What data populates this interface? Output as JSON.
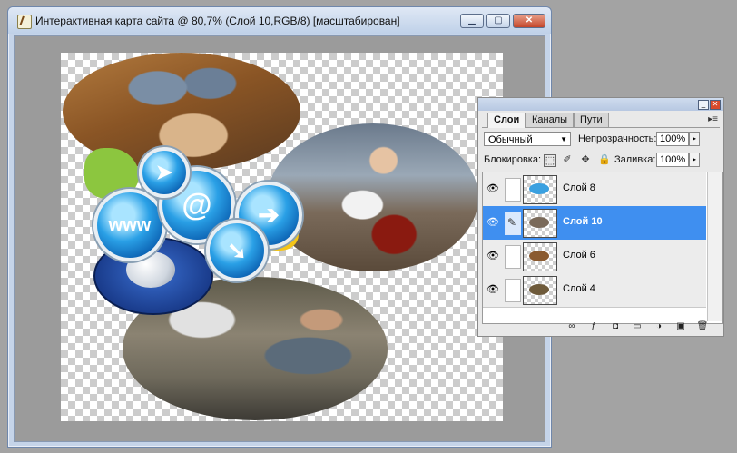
{
  "document_window": {
    "title": "Интерактивная карта сайта @ 80,7% (Слой 10,RGB/8) [масштабирован]",
    "buttons": {
      "minimize": "▁",
      "maximize": "▢",
      "close": "✕"
    },
    "icon": "document-icon",
    "canvas_elements": [
      "photo-desk-oval",
      "photo-bike-oval",
      "photo-office-oval",
      "www-icon",
      "at-icon",
      "arrow-right-icon",
      "arrow-down-icon",
      "cursor-icon",
      "mouse-icon"
    ],
    "icon_glyphs": {
      "www": "www",
      "at": "@",
      "arrow_right": "➔",
      "arrow_down": "➘",
      "cursor": "➤"
    }
  },
  "layers_panel": {
    "tabs": [
      {
        "label": "Слои",
        "active": true
      },
      {
        "label": "Каналы",
        "active": false
      },
      {
        "label": "Пути",
        "active": false
      }
    ],
    "menu_arrow": "▸≡",
    "blend_mode": "Обычный",
    "opacity_label": "Непрозрачность:",
    "opacity_value": "100%",
    "lock_label": "Блокировка:",
    "fill_label": "Заливка:",
    "fill_value": "100%",
    "stepper_glyph": "▸",
    "lock_icons": {
      "transparency": "⬚",
      "brush": "✐",
      "move": "✥",
      "lock": "🔒"
    },
    "eye_glyph": "👁",
    "layers": [
      {
        "name": "Слой 8",
        "selected": false,
        "thumb_color": "#3aa0e0"
      },
      {
        "name": "Слой 10",
        "selected": true,
        "thumb_color": "#7a6a5a"
      },
      {
        "name": "Слой 6",
        "selected": false,
        "thumb_color": "#8a5a30"
      },
      {
        "name": "Слой 4",
        "selected": false,
        "thumb_color": "#6e5a3a"
      }
    ],
    "bottom_icons": [
      {
        "name": "link-layers-icon",
        "glyph": "∞"
      },
      {
        "name": "layer-style-icon",
        "glyph": "ƒ"
      },
      {
        "name": "mask-icon",
        "glyph": "◘"
      },
      {
        "name": "folder-icon",
        "glyph": "▭"
      },
      {
        "name": "adjustment-icon",
        "glyph": "◑"
      },
      {
        "name": "new-layer-icon",
        "glyph": "▣"
      },
      {
        "name": "trash-icon",
        "glyph": "🗑"
      }
    ],
    "panel_controls": {
      "minimize": "_",
      "close": "✕"
    }
  },
  "colors": {
    "selected_layer": "#3f8ff0",
    "window_frame": "#c5d4e9",
    "workspace": "#a3a3a3"
  }
}
